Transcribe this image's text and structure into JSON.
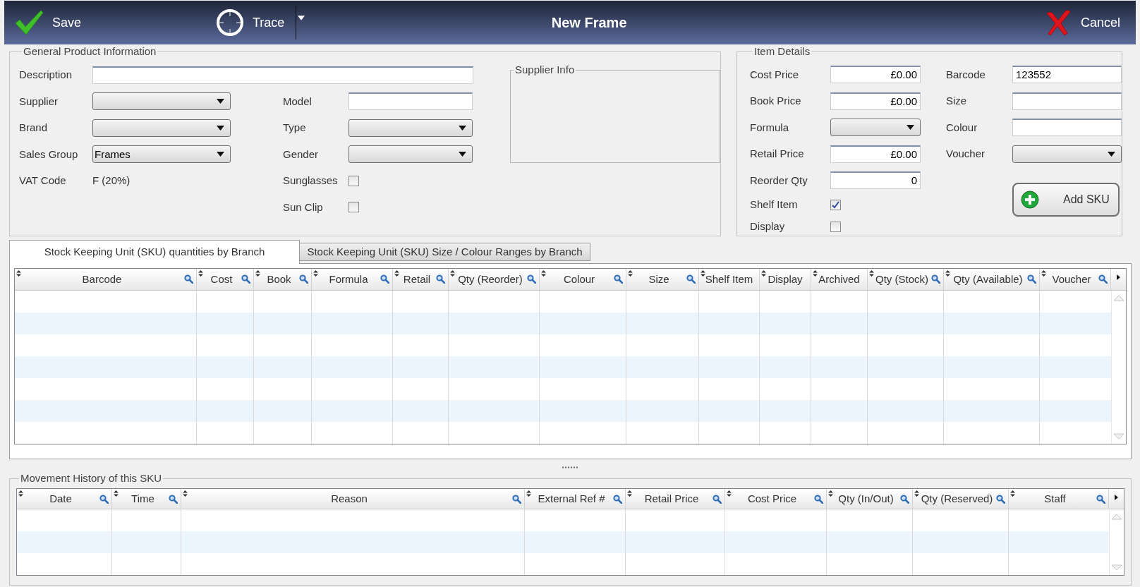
{
  "header": {
    "title": "New Frame",
    "actions": [
      {
        "kind": "save",
        "label": "Save"
      },
      {
        "kind": "trace",
        "label": "Trace"
      },
      {
        "kind": "cancel",
        "label": "Cancel"
      }
    ]
  },
  "general": {
    "legend": "General Product Information",
    "description": {
      "label": "Description",
      "kind": "text"
    },
    "left_fields": [
      {
        "label": "Supplier",
        "kind": "select"
      },
      {
        "label": "Brand",
        "kind": "select"
      },
      {
        "label": "Sales Group",
        "kind": "select",
        "value": "Frames"
      },
      {
        "label": "VAT Code",
        "kind": "static",
        "value": "F (20%)"
      }
    ],
    "middle_fields": [
      {
        "label": "Model",
        "kind": "text"
      },
      {
        "label": "Type",
        "kind": "select"
      },
      {
        "label": "Gender",
        "kind": "select"
      },
      {
        "label": "Sunglasses",
        "kind": "checkbox",
        "checked": false
      },
      {
        "label": "Sun Clip",
        "kind": "checkbox",
        "checked": false
      }
    ],
    "supplier_info": {
      "legend": "Supplier Info"
    }
  },
  "item_details": {
    "legend": "Item Details",
    "left_fields": [
      {
        "label": "Cost Price",
        "kind": "amount",
        "value": "£0.00"
      },
      {
        "label": "Book Price",
        "kind": "amount",
        "value": "£0.00"
      },
      {
        "label": "Formula",
        "kind": "select"
      },
      {
        "label": "Retail Price",
        "kind": "amount",
        "value": "£0.00"
      },
      {
        "label": "Reorder Qty",
        "kind": "amount",
        "value": "0"
      },
      {
        "label": "Shelf Item",
        "kind": "checkbox",
        "checked": true
      },
      {
        "label": "Display",
        "kind": "checkbox",
        "checked": false
      }
    ],
    "right_fields": [
      {
        "label": "Barcode",
        "kind": "text",
        "value": "123552"
      },
      {
        "label": "Size",
        "kind": "text"
      },
      {
        "label": "Colour",
        "kind": "text"
      },
      {
        "label": "Voucher",
        "kind": "select"
      }
    ],
    "add_button": "Add SKU"
  },
  "tabs": [
    {
      "label": "Stock Keeping Unit (SKU) quantities by Branch",
      "selected": true
    },
    {
      "label": "Stock Keeping Unit (SKU) Size / Colour Ranges by Branch",
      "selected": false
    }
  ],
  "sku_grid": {
    "columns": [
      {
        "label": "Barcode",
        "searchable": true
      },
      {
        "label": "Cost",
        "searchable": true
      },
      {
        "label": "Book",
        "searchable": true
      },
      {
        "label": "Formula",
        "searchable": true
      },
      {
        "label": "Retail",
        "searchable": true
      },
      {
        "label": "Qty (Reorder)",
        "searchable": true
      },
      {
        "label": "Colour",
        "searchable": true
      },
      {
        "label": "Size",
        "searchable": true
      },
      {
        "label": "Shelf Item",
        "searchable": false
      },
      {
        "label": "Display",
        "searchable": false
      },
      {
        "label": "Archived",
        "searchable": false
      },
      {
        "label": "Qty (Stock)",
        "searchable": true
      },
      {
        "label": "Qty (Available)",
        "searchable": true
      },
      {
        "label": "Voucher",
        "searchable": true
      }
    ]
  },
  "movement": {
    "legend": "Movement History of this SKU",
    "columns": [
      {
        "label": "Date",
        "searchable": true
      },
      {
        "label": "Time",
        "searchable": true
      },
      {
        "label": "Reason",
        "searchable": true
      },
      {
        "label": "External Ref #",
        "searchable": true
      },
      {
        "label": "Retail Price",
        "searchable": true
      },
      {
        "label": "Cost Price",
        "searchable": true
      },
      {
        "label": "Qty (In/Out)",
        "searchable": true
      },
      {
        "label": "Qty (Reserved)",
        "searchable": true
      },
      {
        "label": "Staff",
        "searchable": true
      }
    ]
  }
}
